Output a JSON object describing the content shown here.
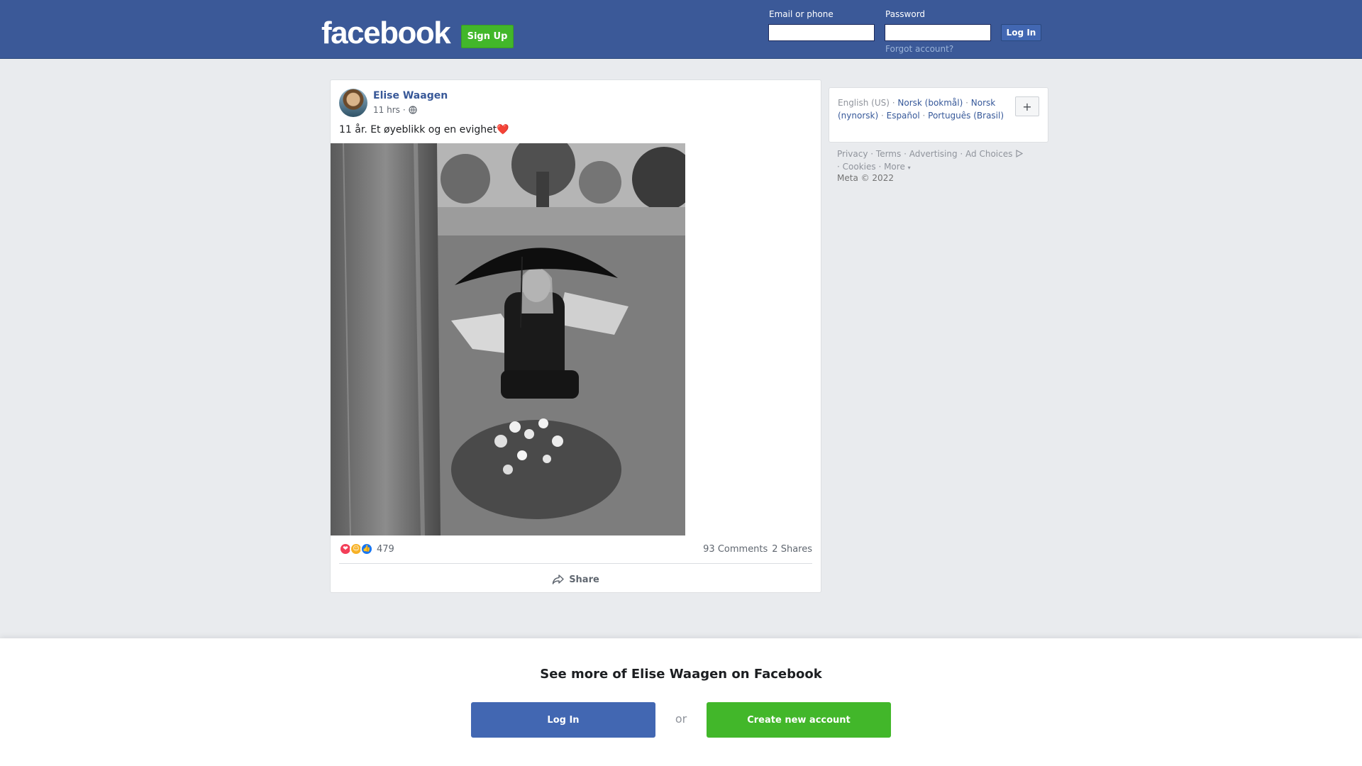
{
  "header": {
    "logo": "facebook",
    "signup_label": "Sign Up",
    "email_label": "Email or phone",
    "password_label": "Password",
    "login_label": "Log In",
    "forgot_label": "Forgot account?"
  },
  "post": {
    "author": "Elise Waagen",
    "time": "11 hrs",
    "separator": "·",
    "text": "11 år. Et øyeblikk og en evighet❤️",
    "reaction_count": "479",
    "comments": "93 Comments",
    "shares": "2 Shares",
    "share_label": "Share"
  },
  "languages": {
    "current": "English (US)",
    "items": [
      "Norsk (bokmål)",
      "Norsk (nynorsk)",
      "Español",
      "Português (Brasil)"
    ],
    "more_label": "+"
  },
  "footer": {
    "links": [
      "Privacy",
      "Terms",
      "Advertising",
      "Ad Choices",
      "Cookies",
      "More"
    ],
    "copyright": "Meta © 2022"
  },
  "banner": {
    "title": "See more of Elise Waagen on Facebook",
    "login_label": "Log In",
    "or_label": "or",
    "create_label": "Create new account"
  },
  "colors": {
    "brand": "#3b5998",
    "green": "#42b72a",
    "link": "#365899"
  }
}
